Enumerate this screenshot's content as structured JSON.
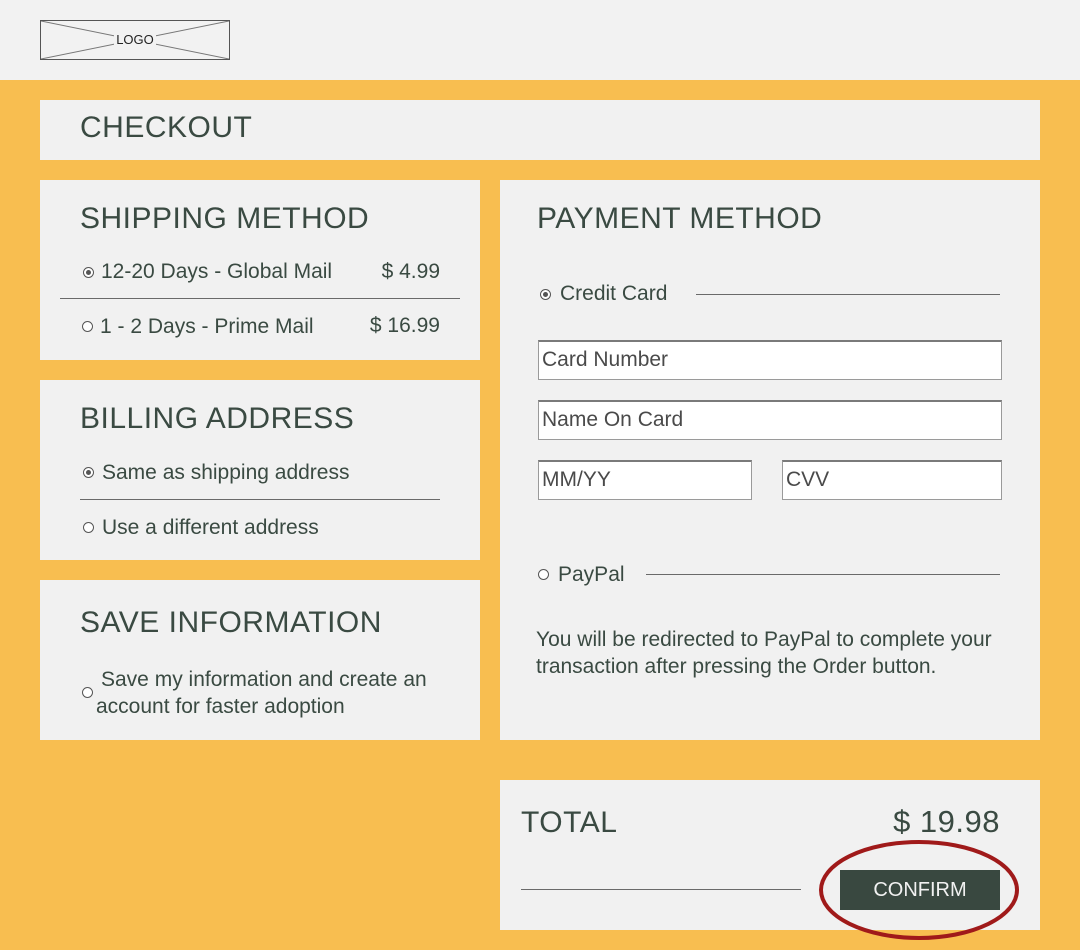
{
  "header": {
    "logo_text": "LOGO"
  },
  "checkout": {
    "title": "CHECKOUT"
  },
  "shipping": {
    "title": "SHIPPING METHOD",
    "options": [
      {
        "label": "12-20 Days - Global Mail",
        "price": "$ 4.99",
        "selected": true
      },
      {
        "label": "1 - 2 Days - Prime Mail",
        "price": "$ 16.99",
        "selected": false
      }
    ]
  },
  "billing": {
    "title": "BILLING ADDRESS",
    "options": [
      {
        "label": "Same as shipping address",
        "selected": true
      },
      {
        "label": "Use a different address",
        "selected": false
      }
    ]
  },
  "save_info": {
    "title": "SAVE INFORMATION",
    "line1": "Save my information and create an",
    "line2": "account for faster adoption",
    "selected": false
  },
  "payment": {
    "title": "PAYMENT METHOD",
    "credit_card": {
      "label": "Credit Card",
      "selected": true
    },
    "fields": {
      "card_number": "Card Number",
      "name_on_card": "Name On Card",
      "expiry": "MM/YY",
      "cvv": "CVV"
    },
    "paypal": {
      "label": "PayPal",
      "selected": false,
      "note_line1": "You will be redirected to PayPal to complete your",
      "note_line2": "transaction after pressing the Order button."
    }
  },
  "total": {
    "label": "TOTAL",
    "amount": "$ 19.98",
    "confirm_label": "CONFIRM"
  },
  "colors": {
    "background": "#f8be50",
    "panel": "#f1f1f1",
    "text": "#3a4a42",
    "button": "#394840",
    "highlight_ring": "#a01a1a"
  }
}
